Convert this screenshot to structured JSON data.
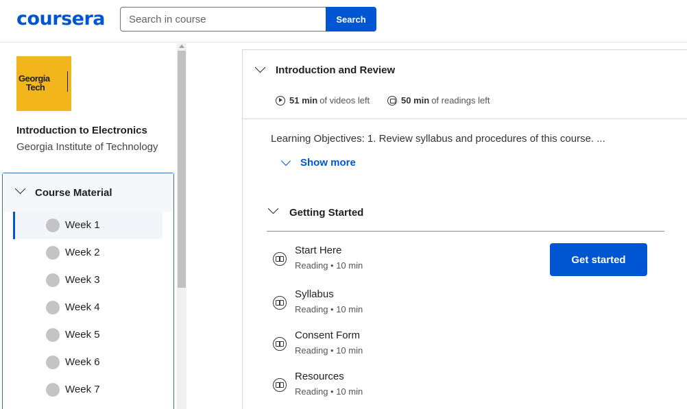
{
  "header": {
    "logo": "coursera",
    "search_placeholder": "Search in course",
    "search_button": "Search"
  },
  "sidebar": {
    "partner_logo": {
      "line1": "Georgia",
      "line2": "Tech"
    },
    "course_title": "Introduction to Electronics",
    "course_org": "Georgia Institute of Technology",
    "material_title": "Course Material",
    "weeks": [
      "Week 1",
      "Week 2",
      "Week 3",
      "Week 4",
      "Week 5",
      "Week 6",
      "Week 7"
    ],
    "active_week": "Week 1"
  },
  "module": {
    "title": "Introduction and Review",
    "videos_time": "51 min",
    "videos_suffix": "of videos left",
    "readings_time": "50 min",
    "readings_suffix": "of readings left",
    "objectives": "Learning Objectives: 1. Review syllabus and procedures of this course. ...",
    "show_more": "Show more"
  },
  "section": {
    "title": "Getting Started",
    "items": [
      {
        "name": "Start Here",
        "meta": "Reading • 10 min"
      },
      {
        "name": "Syllabus",
        "meta": "Reading • 10 min"
      },
      {
        "name": "Consent Form",
        "meta": "Reading • 10 min"
      },
      {
        "name": "Resources",
        "meta": "Reading • 10 min"
      }
    ],
    "cta": "Get started"
  },
  "colors": {
    "brand": "#0056d2",
    "partner": "#f2b51c"
  }
}
